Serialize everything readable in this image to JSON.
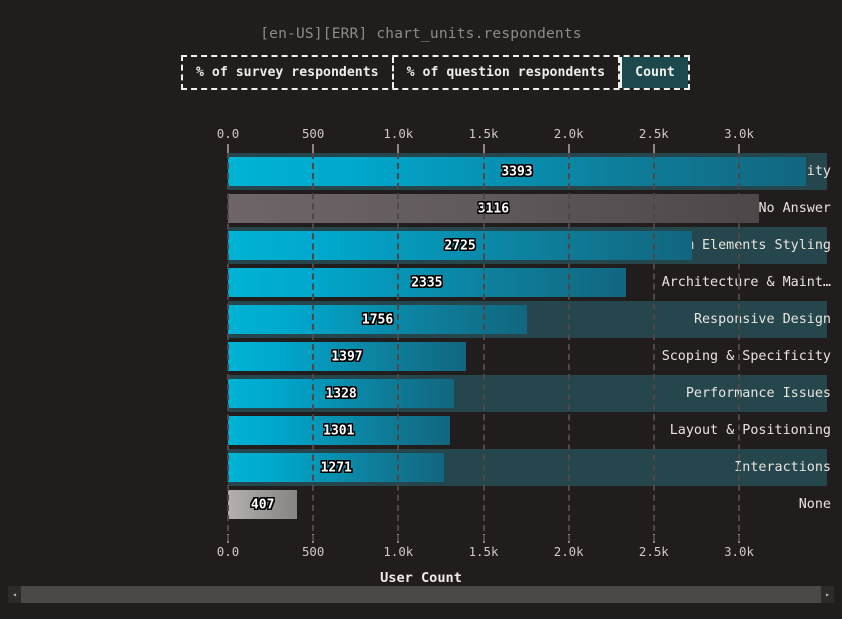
{
  "chart_title": "[en-US][ERR] chart_units.respondents",
  "unit_toggle": {
    "options": [
      {
        "label": "% of survey respondents",
        "selected": false
      },
      {
        "label": "% of question respondents",
        "selected": false
      },
      {
        "label": "Count",
        "selected": true
      }
    ],
    "selected_label": "Count",
    "selected_bg": "#1d494e"
  },
  "scrollbar": {
    "left_arrow": "◂",
    "right_arrow": "▸"
  },
  "chart_data": {
    "type": "bar",
    "orientation": "horizontal",
    "title": "[en-US][ERR] chart_units.respondents",
    "xlabel": "User Count",
    "ylabel": "",
    "xlim": [
      0,
      3516
    ],
    "xticks": [
      0,
      500,
      1000,
      1500,
      2000,
      2500,
      3000
    ],
    "xticklabels": [
      "0.0",
      "500",
      "1.0k",
      "1.5k",
      "2.0k",
      "2.5k",
      "3.0k"
    ],
    "grid": true,
    "legend": false,
    "categories": [
      "Browser Compatability",
      "No Answer",
      "Form Elements Styling",
      "Architecture & Maint…",
      "Responsive Design",
      "Scoping & Specificity",
      "Performance Issues",
      "Layout & Positioning",
      "Interactions",
      "None"
    ],
    "values": [
      3393,
      3116,
      2725,
      2335,
      1756,
      1397,
      1328,
      1301,
      1271,
      407
    ],
    "value_labels": [
      "3393",
      "3116",
      "2725",
      "2335",
      "1756",
      "1397",
      "1328",
      "1301",
      "1271",
      "407"
    ],
    "bar_styles": [
      "teal",
      "gray",
      "teal",
      "teal",
      "teal",
      "teal",
      "teal",
      "teal",
      "teal",
      "light"
    ],
    "colors": {
      "bar_start": "#00b3d4",
      "bar_end": "#12667f",
      "no_answer": "#6e6568",
      "none": "#b4b0ae",
      "track": "#24464c",
      "background": "#211d1d"
    }
  }
}
